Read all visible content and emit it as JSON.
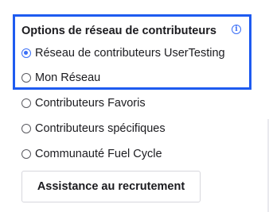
{
  "panel": {
    "title": "Options de réseau de contributeurs",
    "info_icon": "info-icon",
    "accent_color": "#3b6ff6",
    "highlight_color": "#1e5bf0"
  },
  "options": [
    {
      "label": "Réseau de contributeurs UserTesting",
      "checked": true
    },
    {
      "label": "Mon Réseau",
      "checked": false
    },
    {
      "label": "Contributeurs Favoris",
      "checked": false
    },
    {
      "label": "Contributeurs spécifiques",
      "checked": false
    },
    {
      "label": "Communauté Fuel Cycle",
      "checked": false
    }
  ],
  "recruit_button": {
    "label": "Assistance au recrutement"
  }
}
